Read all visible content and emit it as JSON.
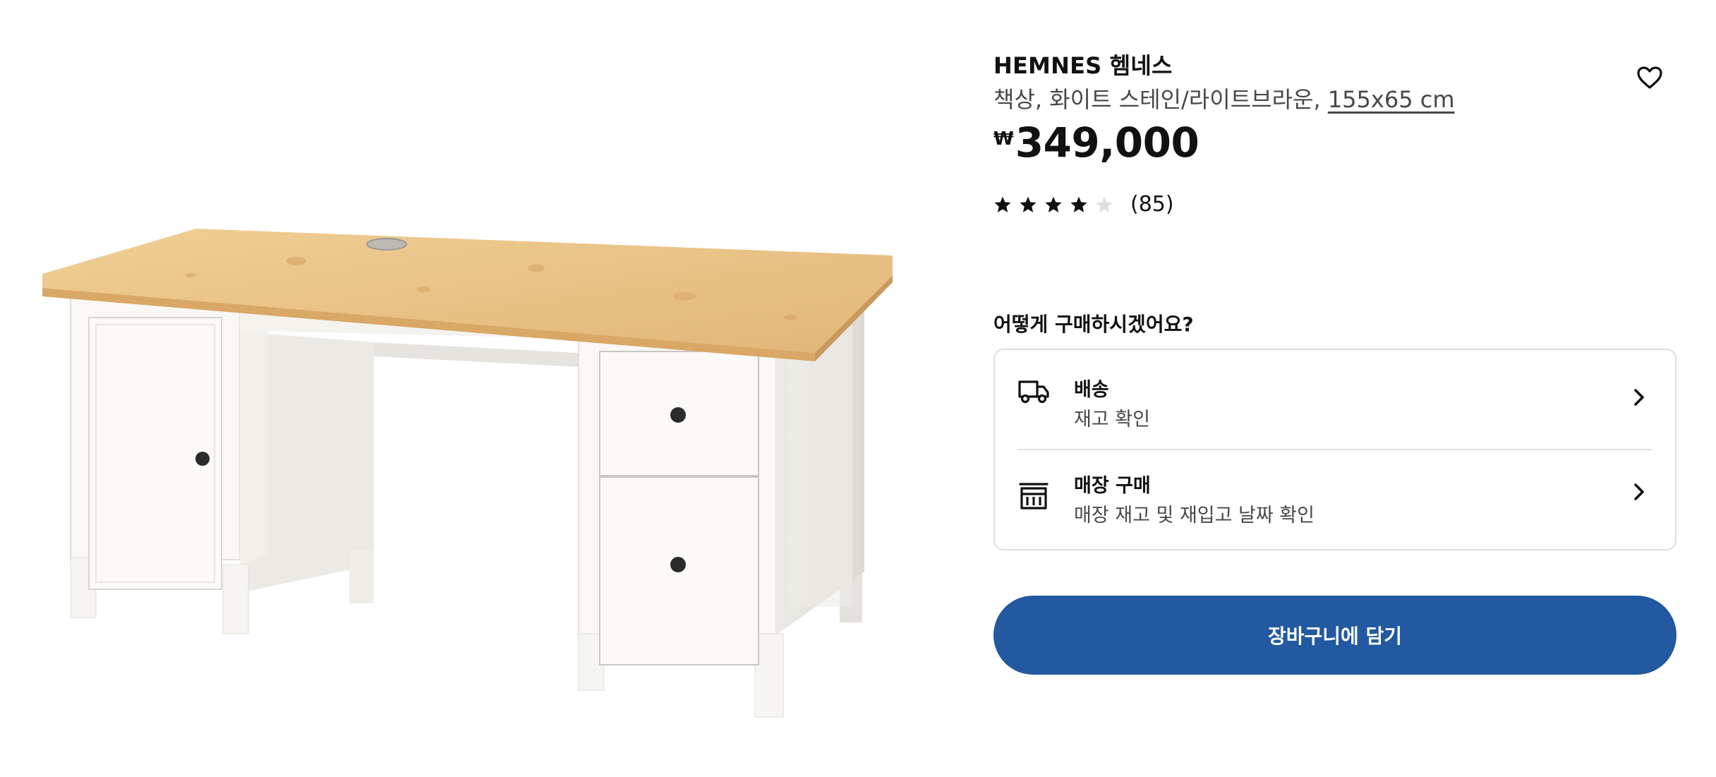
{
  "product": {
    "name": "HEMNES 헴네스",
    "description": "책상, 화이트 스테인/라이트브라운, ",
    "measurement": "155x65 cm",
    "currency_symbol": "₩",
    "price": "349,000",
    "rating": 4,
    "rating_max": 5,
    "review_count": "(85)"
  },
  "colors": {
    "accent": "#2359a0",
    "star_filled": "#111111",
    "star_empty": "#dfdfdf",
    "desk_top": "#e8c48a",
    "desk_body": "#f7f6f2"
  },
  "purchase": {
    "title": "어떻게 구매하시겠어요?",
    "options": [
      {
        "icon": "delivery-truck-icon",
        "title": "배송",
        "subtitle": "재고 확인"
      },
      {
        "icon": "store-icon",
        "title": "매장 구매",
        "subtitle": "매장 재고 및 재입고 날짜 확인"
      }
    ]
  },
  "cart": {
    "label": "장바구니에 담기"
  },
  "icons": {
    "favorite": "heart-icon",
    "option_arrow": "chevron-right-icon"
  }
}
